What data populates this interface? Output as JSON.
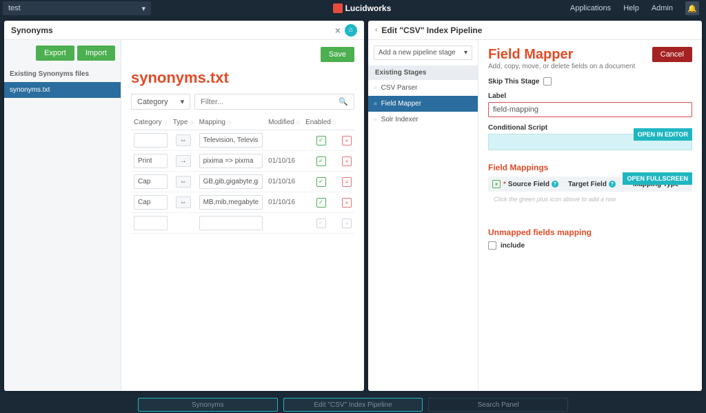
{
  "topbar": {
    "app_selector": "test",
    "brand": "Lucidworks",
    "links": {
      "applications": "Applications",
      "help": "Help",
      "admin": "Admin"
    }
  },
  "left": {
    "title": "Synonyms",
    "buttons": {
      "export": "Export",
      "import": "Import",
      "save": "Save"
    },
    "sidebar": {
      "header": "Existing Synonyms files",
      "item": "synonyms.txt"
    },
    "main_title": "synonyms.txt",
    "category_select": "Category",
    "filter_placeholder": "Filter...",
    "columns": {
      "category": "Category",
      "type": "Type",
      "mapping": "Mapping",
      "modified": "Modified",
      "enabled": "Enabled"
    },
    "rows": [
      {
        "category": "",
        "type": "⇔",
        "mapping": "Television, Televisions, TV, TVs",
        "modified": "",
        "enabled": true,
        "deletable": true
      },
      {
        "category": "Print",
        "type": "→",
        "mapping": "pixima => pixma",
        "modified": "01/10/16",
        "enabled": true,
        "deletable": true
      },
      {
        "category": "Cap",
        "type": "⇔",
        "mapping": "GB,gib,gigabyte,gigabytes",
        "modified": "01/10/16",
        "enabled": true,
        "deletable": true
      },
      {
        "category": "Cap",
        "type": "⇔",
        "mapping": "MB,mib,megabyte,megabytes",
        "modified": "01/10/16",
        "enabled": true,
        "deletable": true
      },
      {
        "category": "",
        "type": "",
        "mapping": "",
        "modified": "",
        "enabled": false,
        "deletable": false
      }
    ]
  },
  "right": {
    "title": "Edit \"CSV\" Index Pipeline",
    "add_stage": "Add a new pipeline stage",
    "stages_header": "Existing Stages",
    "stages": [
      "CSV Parser",
      "Field Mapper",
      "Solr Indexer"
    ],
    "cancel": "Cancel",
    "fm_title": "Field Mapper",
    "fm_sub": "Add, copy, move, or delete fields on a document",
    "skip_label": "Skip This Stage",
    "label_label": "Label",
    "label_value": "field-mapping",
    "cond_label": "Conditional Script",
    "open_editor": "OPEN IN EDITOR",
    "field_mappings": "Field Mappings",
    "open_fullscreen": "OPEN FULLSCREEN",
    "map_cols": {
      "source": "Source Field",
      "target": "Target Field",
      "type": "Mapping Type"
    },
    "hint": "Click the green plus icon above to add a row",
    "unmapped": "Unmapped fields mapping",
    "include": "include"
  },
  "bottom": {
    "tab1": "Synonyms",
    "tab2": "Edit \"CSV\" Index Pipeline",
    "tab3": "Search Panel"
  }
}
